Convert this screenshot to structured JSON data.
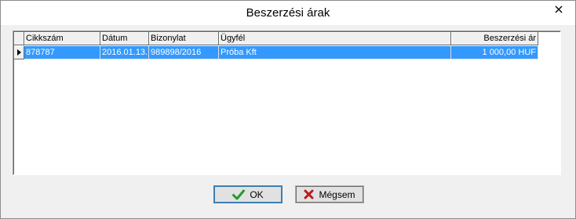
{
  "window": {
    "title": "Beszerzési árak",
    "close_icon": "close-icon"
  },
  "grid": {
    "columns": [
      "Cikkszám",
      "Dátum",
      "Bizonylat",
      "Ügyfél",
      "Beszerzési ár"
    ],
    "rows": [
      {
        "selected": true,
        "cells": [
          "878787",
          "2016.01.13.",
          "989898/2016",
          "Próba Kft",
          "1 000,00 HUF"
        ]
      }
    ]
  },
  "buttons": {
    "ok_label": "OK",
    "ok_icon": "checkmark-icon",
    "ok_icon_color": "#1f9c2a",
    "cancel_label": "Mégsem",
    "cancel_icon": "x-icon",
    "cancel_icon_color": "#c01818"
  },
  "colors": {
    "selection": "#3399ff",
    "window_bg": "#f0f0f0"
  }
}
